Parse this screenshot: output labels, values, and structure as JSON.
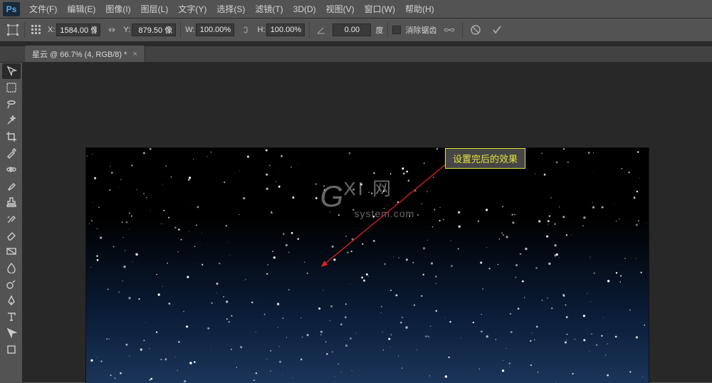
{
  "app": {
    "logo": "Ps"
  },
  "menu": {
    "file": "文件(F)",
    "edit": "编辑(E)",
    "image": "图像(I)",
    "layer": "图层(L)",
    "type": "文字(Y)",
    "select": "选择(S)",
    "filter": "滤镜(T)",
    "three_d": "3D(D)",
    "view": "视图(V)",
    "window": "窗口(W)",
    "help": "帮助(H)"
  },
  "options": {
    "x_label": "X:",
    "x_value": "1584.00 像",
    "y_label": "Y:",
    "y_value": "879.50 像",
    "w_label": "W:",
    "w_value": "100.00%",
    "h_label": "H:",
    "h_value": "100.00%",
    "rot_value": "0.00",
    "rot_unit": "度",
    "antialias": "消除锯齿"
  },
  "tabs": {
    "doc1": {
      "title": "星云 @ 66.7% (4, RGB/8) *"
    }
  },
  "annotation": {
    "text": "设置完后的效果"
  },
  "watermark": {
    "logo_big": "G",
    "logo_cn": "XI 网",
    "logo_sub": "system.com"
  },
  "tools": {
    "move": "move",
    "marquee": "marquee",
    "lasso": "lasso",
    "wand": "wand",
    "crop": "crop",
    "eyedrop": "eyedrop",
    "heal": "heal",
    "brush": "brush",
    "stamp": "stamp",
    "history": "history",
    "eraser": "eraser",
    "gradient": "gradient",
    "blur": "blur",
    "dodge": "dodge",
    "pen": "pen",
    "type": "type",
    "path": "path",
    "rect": "rect"
  }
}
